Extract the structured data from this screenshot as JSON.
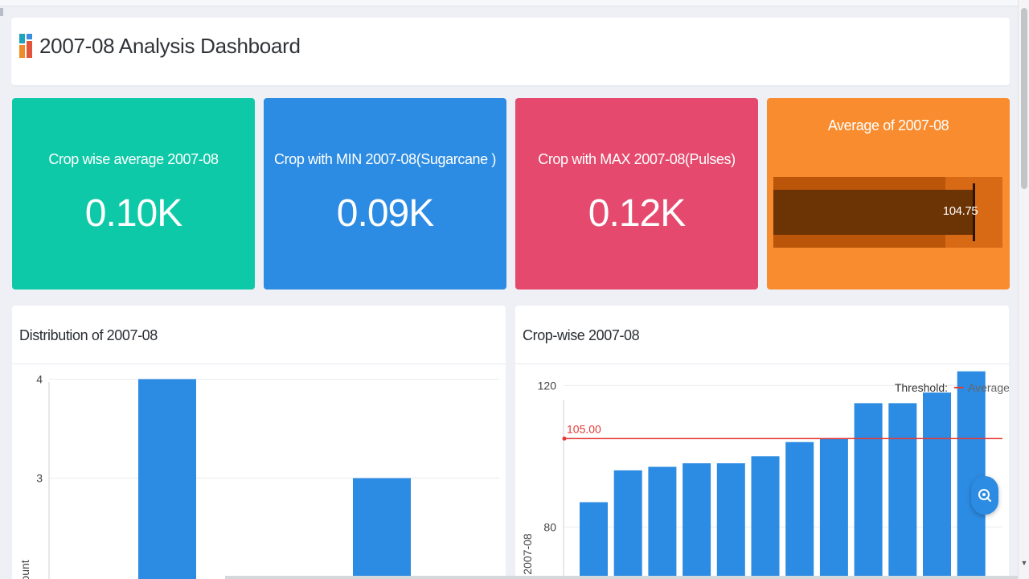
{
  "header": {
    "title": "2007-08 Analysis Dashboard"
  },
  "kpis": [
    {
      "label": "Crop wise average 2007-08",
      "value": "0.10K",
      "color": "#0ec9a8"
    },
    {
      "label": "Crop with MIN 2007-08(Sugarcane )",
      "value": "0.09K",
      "color": "#2c8be2"
    },
    {
      "label": "Crop with MAX 2007-08(Pulses)",
      "value": "0.12K",
      "color": "#e5496d"
    }
  ],
  "gauge": {
    "title": "Average of 2007-08",
    "value_label": "104.75",
    "value": 104.75,
    "target": 105,
    "range": [
      0,
      120
    ],
    "band_breaks": [
      90,
      120
    ],
    "color": "#f98c2e"
  },
  "distribution_panel": {
    "title": "Distribution of 2007-08"
  },
  "crop_panel": {
    "title": "Crop-wise 2007-08"
  },
  "chart_data": [
    {
      "type": "bar",
      "title": "Distribution of 2007-08",
      "ylabel": "Count",
      "ylim": [
        1.9,
        4.15
      ],
      "yticks": [
        3,
        4
      ],
      "categories": [
        "",
        ""
      ],
      "values": [
        4,
        3
      ],
      "grid": true,
      "bar_color": "#2c8be2"
    },
    {
      "type": "bar",
      "title": "Crop-wise 2007-08",
      "ylabel": "2007-08",
      "ylim": [
        63,
        126
      ],
      "yticks": [
        80,
        120
      ],
      "values": [
        87,
        96,
        97,
        98,
        98,
        100,
        104,
        105,
        115,
        115,
        118,
        124
      ],
      "threshold": {
        "value": 105,
        "label": "105.00",
        "color": "#e53935"
      },
      "legend": {
        "title": "Threshold:",
        "item": "Average",
        "position": "top-right"
      },
      "grid": true,
      "bar_color": "#2c8be2"
    }
  ]
}
